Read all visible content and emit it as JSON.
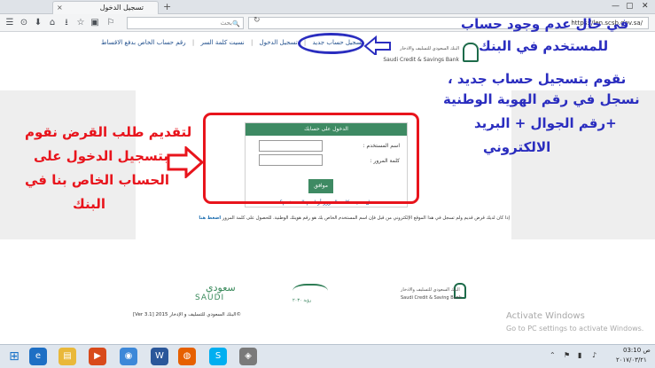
{
  "browser": {
    "tab_title": "تسجيل الدخول",
    "tab_close": "×",
    "new_tab": "+",
    "window_controls": [
      "—",
      "▢",
      "✕"
    ],
    "search_placeholder": "بحث",
    "search_icon": "🔍",
    "url": "https://len.scsb.gov.sa/",
    "reload_icon": "↻",
    "nav_icons": [
      "☰",
      "⊙",
      "⬇",
      "⌂",
      "⭳",
      "☆",
      "▣",
      "⚐"
    ]
  },
  "site": {
    "links": [
      "تسجيل حساب جديد",
      "|",
      "تسجيل الدخول",
      "|",
      "نسيت كلمة السر",
      "|",
      "رقم حساب الخاص بدفع الاقساط"
    ],
    "logo_ar": "البنك السعودي للتسليف والادخار",
    "logo_en": "Saudi Credit & Savings Bank"
  },
  "login": {
    "header": "الدخول على حسابك",
    "username_label": "اسم المستخدم :",
    "password_label": "كلمة المرور :",
    "submit": "موافق",
    "forgot": "هل نسيت كلمة المرور أو اسم المستخدم؟"
  },
  "info": {
    "text": "إذا كان لديك قرض قديم ولم تسجل في هذا الموقع الإلكتروني من قبل فإن اسم المستخدم الخاص بك هو رقم هويتك الوطنية. للحصول على كلمة المرور",
    "link": "اضغط هنا"
  },
  "footer": {
    "saudi_ar": "سعودي",
    "saudi_en": "SAUDI",
    "emblem_text": "رؤية ٢٠٣٠",
    "bank_ar": "البنك السعودي للتسليف والادخار",
    "bank_en": "Saudi Credit & Saving Bank",
    "copyright": "[Ver 3.1] البنك السعودي للتسليف و الإدخار 2015©"
  },
  "annotations": {
    "blue": [
      "في حال عدم وجود حساب",
      "للمستخدم في البنك",
      "نقوم بتسجيل حساب جديد ،",
      "نسجل في رقم الهوية الوطنية",
      "+رقم الجوال + البريد",
      "الالكتروني"
    ],
    "red": [
      "لتقديم طلب القرض نقوم",
      "بتسجيل الدخول على",
      "الحساب الخاص بنا في",
      "البنك"
    ],
    "arrow": "⇨",
    "colors": {
      "red": "#e8141c",
      "blue": "#2a2dbf"
    }
  },
  "watermark": {
    "line1": "Activate Windows",
    "line2": "Go to PC settings to activate Windows."
  },
  "taskbar": {
    "apps": [
      "⊞",
      "e",
      "▤",
      "▶",
      "◉",
      "W",
      "◍",
      "S",
      "◈"
    ],
    "tray": [
      "⌃",
      "⚑",
      "▮",
      "♪"
    ],
    "time": "03:10 ص",
    "date": "٢٠١٧/٠٣/٢١"
  }
}
